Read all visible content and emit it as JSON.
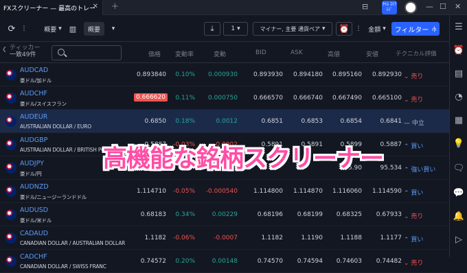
{
  "tab": {
    "title": "FXスクリーナー — 最高のトレー",
    "close": "✕",
    "new": "+"
  },
  "window": {
    "logo_text": "ﾀｲﾑ ｽﾄﾗﾃｼﾞ",
    "min": "—",
    "max": "☐",
    "close": "✕"
  },
  "toolbar": {
    "refresh": "⟳",
    "more": "⋮",
    "view1": "概要",
    "view1_arrow": "▾",
    "view2": "概要",
    "view2_arrow": "▾",
    "timeframe": "1",
    "timeframe_arrow": "▾",
    "pairs": "マイナー, 主要 通貨ペア",
    "pairs_arrow": "▾",
    "amount": "金額",
    "amount_arrow": "▾",
    "filter": "フィルター",
    "filter_icon": "⫛"
  },
  "columns": {
    "ticker": "ティッカー",
    "count": "一致49件",
    "price": "価格",
    "change_pct": "変動率",
    "change": "変動",
    "bid": "BID",
    "ask": "ASK",
    "high": "高値",
    "low": "安値",
    "rating": "テクニカル評価"
  },
  "rows": [
    {
      "symbol": "AUDCAD",
      "desc": "豪ドル/加ドル",
      "price": "0.893840",
      "chp": "0.10%",
      "chp_dir": "pos",
      "ch": "0.000930",
      "ch_dir": "pos",
      "bid": "0.893930",
      "ask": "0.894180",
      "high": "0.895160",
      "low": "0.892930",
      "rating": "⌄ 売り",
      "rating_type": "sell",
      "highlight": false
    },
    {
      "symbol": "AUDCHF",
      "desc": "豪ドル/スイスフラン",
      "price": "0.666620",
      "chp": "0.11%",
      "chp_dir": "pos",
      "ch": "0.000750",
      "ch_dir": "pos",
      "bid": "0.666570",
      "ask": "0.666740",
      "high": "0.667490",
      "low": "0.665100",
      "rating": "⌄ 売り",
      "rating_type": "sell",
      "highlight": true
    },
    {
      "symbol": "AUDEUR",
      "desc": "AUSTRALIAN DOLLAR / EURO",
      "price": "0.6850",
      "chp": "0.18%",
      "chp_dir": "pos",
      "ch": "0.0012",
      "ch_dir": "pos",
      "bid": "0.6851",
      "ask": "0.6853",
      "high": "0.6854",
      "low": "0.6841",
      "rating": "— 中立",
      "rating_type": "neutral",
      "highlight": false
    },
    {
      "symbol": "AUDGBP",
      "desc": "AUSTRALIAN DOLLAR / BRITISH POUND",
      "price": "0.5887",
      "chp": "-0.03%",
      "chp_dir": "neg",
      "ch": "-0.0002",
      "ch_dir": "neg",
      "bid": "0.5891",
      "ask": "0.5891",
      "high": "0.5899",
      "low": "0.5887",
      "rating": "⌃ 買い",
      "rating_type": "buy",
      "highlight": false
    },
    {
      "symbol": "AUDJPY",
      "desc": "豪ドル/円",
      "price": "",
      "chp": "",
      "chp_dir": "neu",
      "ch": "",
      "ch_dir": "neu",
      "bid": "",
      "ask": "",
      "high": "95.90",
      "low": "95.534",
      "rating": "⌃ 強い買い",
      "rating_type": "buy",
      "highlight": false
    },
    {
      "symbol": "AUDNZD",
      "desc": "豪ドル/ニュージーランドドル",
      "price": "1.114710",
      "chp": "-0.05%",
      "chp_dir": "neg",
      "ch": "-0.000540",
      "ch_dir": "neg",
      "bid": "1.114800",
      "ask": "1.114870",
      "high": "1.116060",
      "low": "1.114590",
      "rating": "⌃ 買い",
      "rating_type": "buy",
      "highlight": false
    },
    {
      "symbol": "AUDUSD",
      "desc": "豪ドル/米ドル",
      "price": "0.68183",
      "chp": "0.34%",
      "chp_dir": "pos",
      "ch": "0.00229",
      "ch_dir": "pos",
      "bid": "0.68196",
      "ask": "0.68199",
      "high": "0.68325",
      "low": "0.67933",
      "rating": "⌄ 売り",
      "rating_type": "sell",
      "highlight": false
    },
    {
      "symbol": "CADAUD",
      "desc": "CANADIAN DOLLAR / AUSTRALIAN DOLLAR",
      "price": "1.1182",
      "chp": "-0.06%",
      "chp_dir": "neg",
      "ch": "-0.0007",
      "ch_dir": "neg",
      "bid": "1.1182",
      "ask": "1.1190",
      "high": "1.1188",
      "low": "1.1177",
      "rating": "⌃ 買い",
      "rating_type": "buy",
      "highlight": false
    },
    {
      "symbol": "CADCHF",
      "desc": "CANADIAN DOLLAR / SWISS FRANC",
      "price": "0.74572",
      "chp": "0.20%",
      "chp_dir": "pos",
      "ch": "0.00148",
      "ch_dir": "pos",
      "bid": "0.74570",
      "ask": "0.74594",
      "high": "0.74603",
      "low": "0.74482",
      "rating": "⌄ 売り",
      "rating_type": "sell",
      "highlight": false
    }
  ],
  "selected_row": 2,
  "overlay_text": "高機能な銘柄スクリーナー",
  "colors": {
    "accent": "#2962ff",
    "positive": "#26a69a",
    "negative": "#ef5350",
    "overlay": "#ff4da6"
  }
}
